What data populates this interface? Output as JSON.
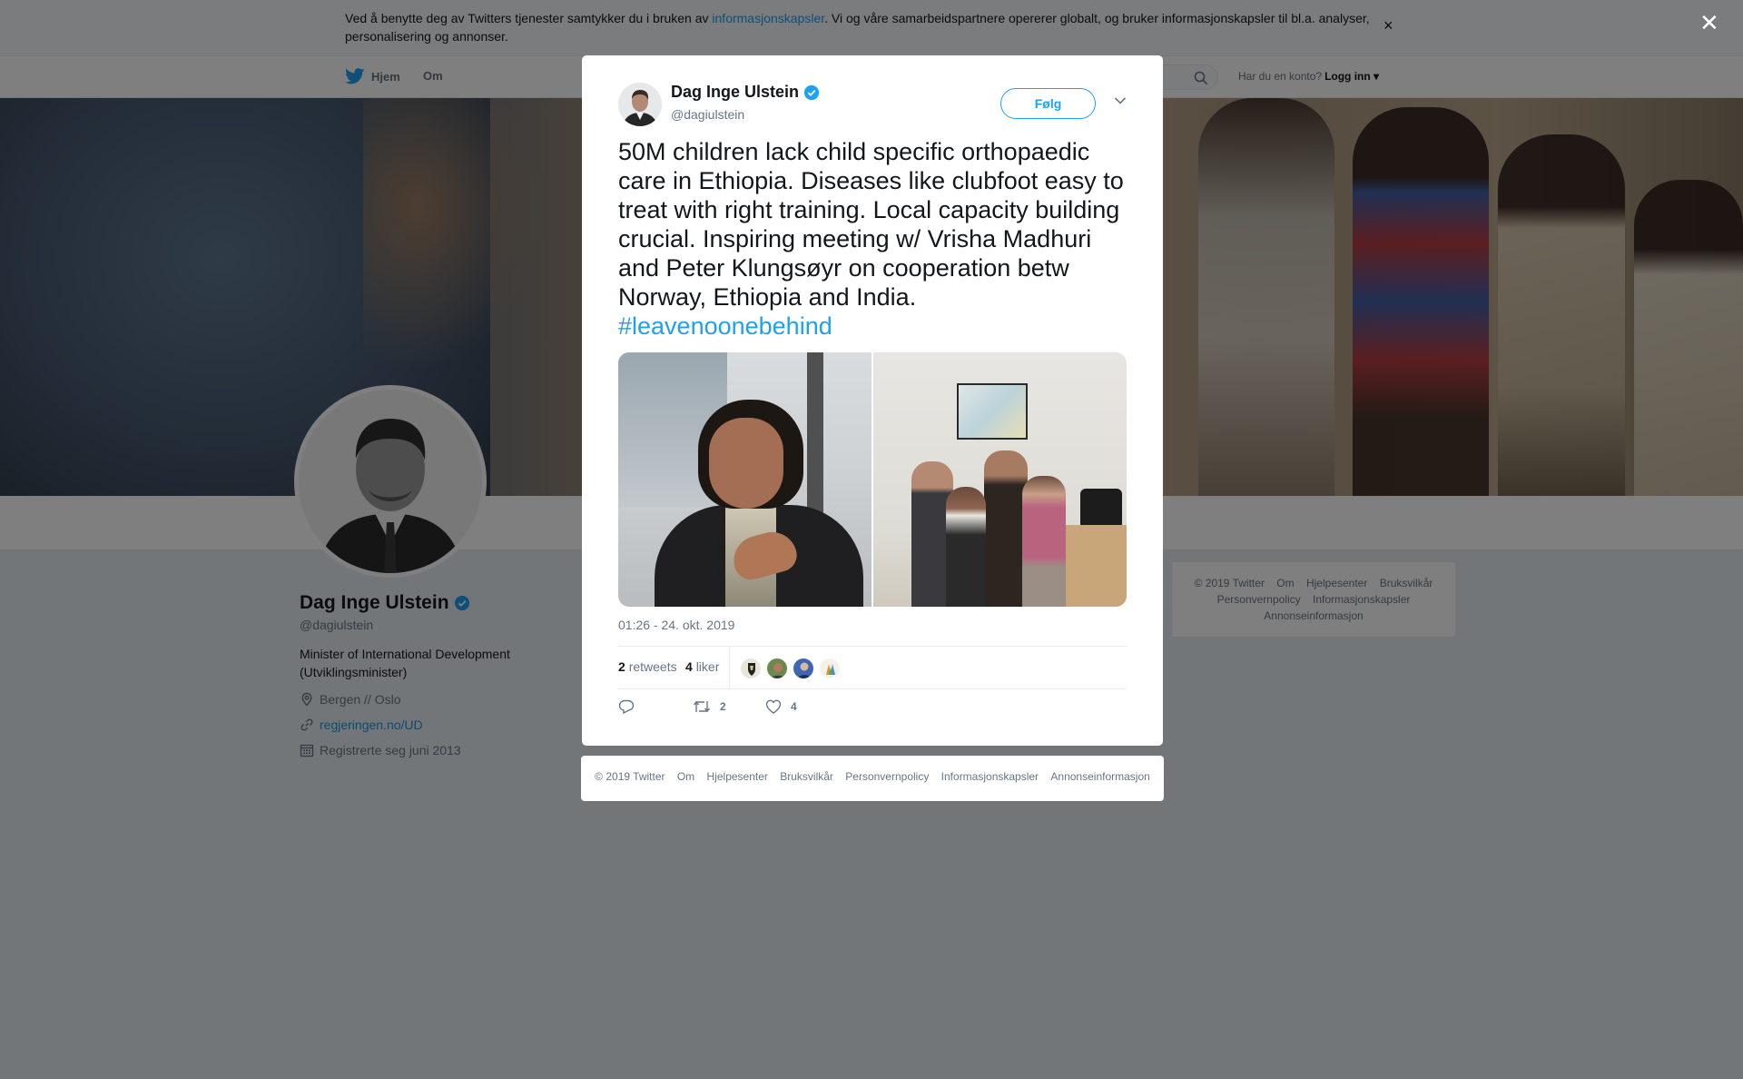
{
  "cookie_banner": {
    "text_before": "Ved å benytte deg av Twitters tjenester samtykker du i bruken av ",
    "link": "informasjonskapsler",
    "text_after": ". Vi og våre samarbeidspartnere opererer globalt, og bruker informasjonskapsler til bl.a. analyser, personalisering og annonser.",
    "close": "×"
  },
  "nav": {
    "home": "Hjem",
    "about": "Om",
    "account_prompt": "Har du en konto?",
    "login": "Logg inn"
  },
  "profile": {
    "name": "Dag Inge Ulstein",
    "handle": "@dagiulstein",
    "bio": "Minister of International Development (Utviklingsminister)",
    "location": "Bergen // Oslo",
    "website": "regjeringen.no/UD",
    "joined": "Registrerte seg juni 2013"
  },
  "sidebar_footer": [
    "© 2019 Twitter",
    "Om",
    "Hjelpesenter",
    "Bruksvilkår",
    "Personvernpolicy",
    "Informasjonskapsler",
    "Annonseinformasjon"
  ],
  "tweet": {
    "author_name": "Dag Inge Ulstein",
    "author_handle": "@dagiulstein",
    "follow_label": "Følg",
    "text": "50M children lack child specific orthopaedic care in Ethiopia. Diseases like clubfoot easy to treat with right training. Local capacity building crucial. Inspiring meeting w/ Vrisha Madhuri and Peter Klungsøyr on cooperation betw Norway, Ethiopia and India.",
    "hashtag": "#leavenoonebehind",
    "timestamp": "01:26 - 24. okt. 2019",
    "retweets_count": "2",
    "retweets_label": "retweets",
    "likes_count": "4",
    "likes_label": "liker",
    "action_retweet_count": "2",
    "action_like_count": "4"
  },
  "modal_footer": [
    "© 2019 Twitter",
    "Om",
    "Hjelpesenter",
    "Bruksvilkår",
    "Personvernpolicy",
    "Informasjonskapsler",
    "Annonseinformasjon"
  ],
  "overlay_close": "✕",
  "colors": {
    "accent": "#1da1f2",
    "verified": "#1da1f2",
    "overlay": "rgba(0,0,0,0.5)"
  },
  "icons": [
    "twitter-bird-icon",
    "search-icon",
    "verified-badge-icon",
    "location-icon",
    "link-icon",
    "calendar-icon",
    "chevron-down-icon",
    "reply-icon",
    "retweet-icon",
    "heart-icon",
    "close-icon"
  ]
}
